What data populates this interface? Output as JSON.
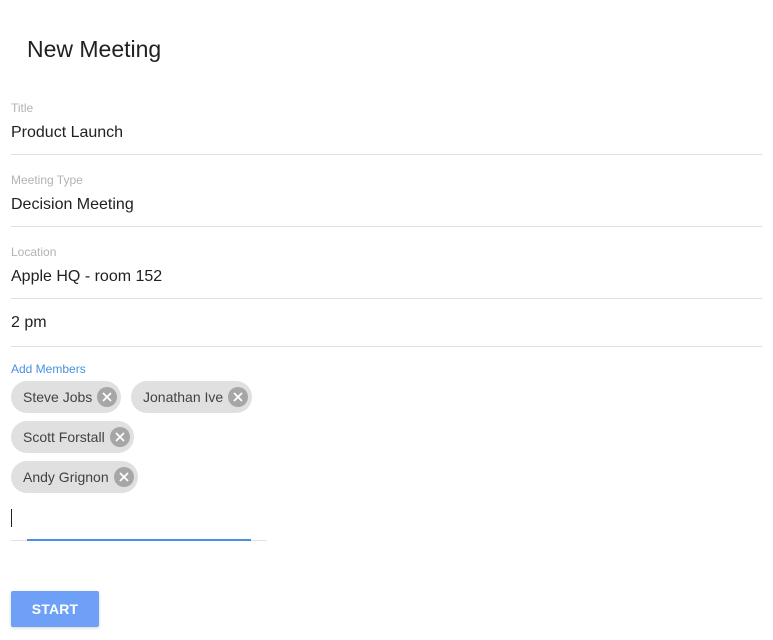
{
  "page": {
    "title": "New Meeting"
  },
  "form": {
    "title": {
      "label": "Title",
      "value": "Product Launch"
    },
    "meeting_type": {
      "label": "Meeting Type",
      "value": "Decision Meeting"
    },
    "location": {
      "label": "Location",
      "value": "Apple HQ - room 152"
    },
    "time": {
      "value": "2 pm"
    },
    "members": {
      "label": "Add Members",
      "chips": [
        {
          "label": "Steve Jobs"
        },
        {
          "label": "Jonathan Ive"
        },
        {
          "label": "Scott Forstall"
        },
        {
          "label": "Andy Grignon"
        }
      ],
      "input_value": ""
    }
  },
  "actions": {
    "start_label": "START"
  },
  "icons": {
    "chip_remove": "close-circle-icon"
  },
  "colors": {
    "accent": "#4a90e2",
    "button": "#6ea0f7",
    "chip_background": "#e0e0e0",
    "chip_remove": "#a6a6a6"
  }
}
